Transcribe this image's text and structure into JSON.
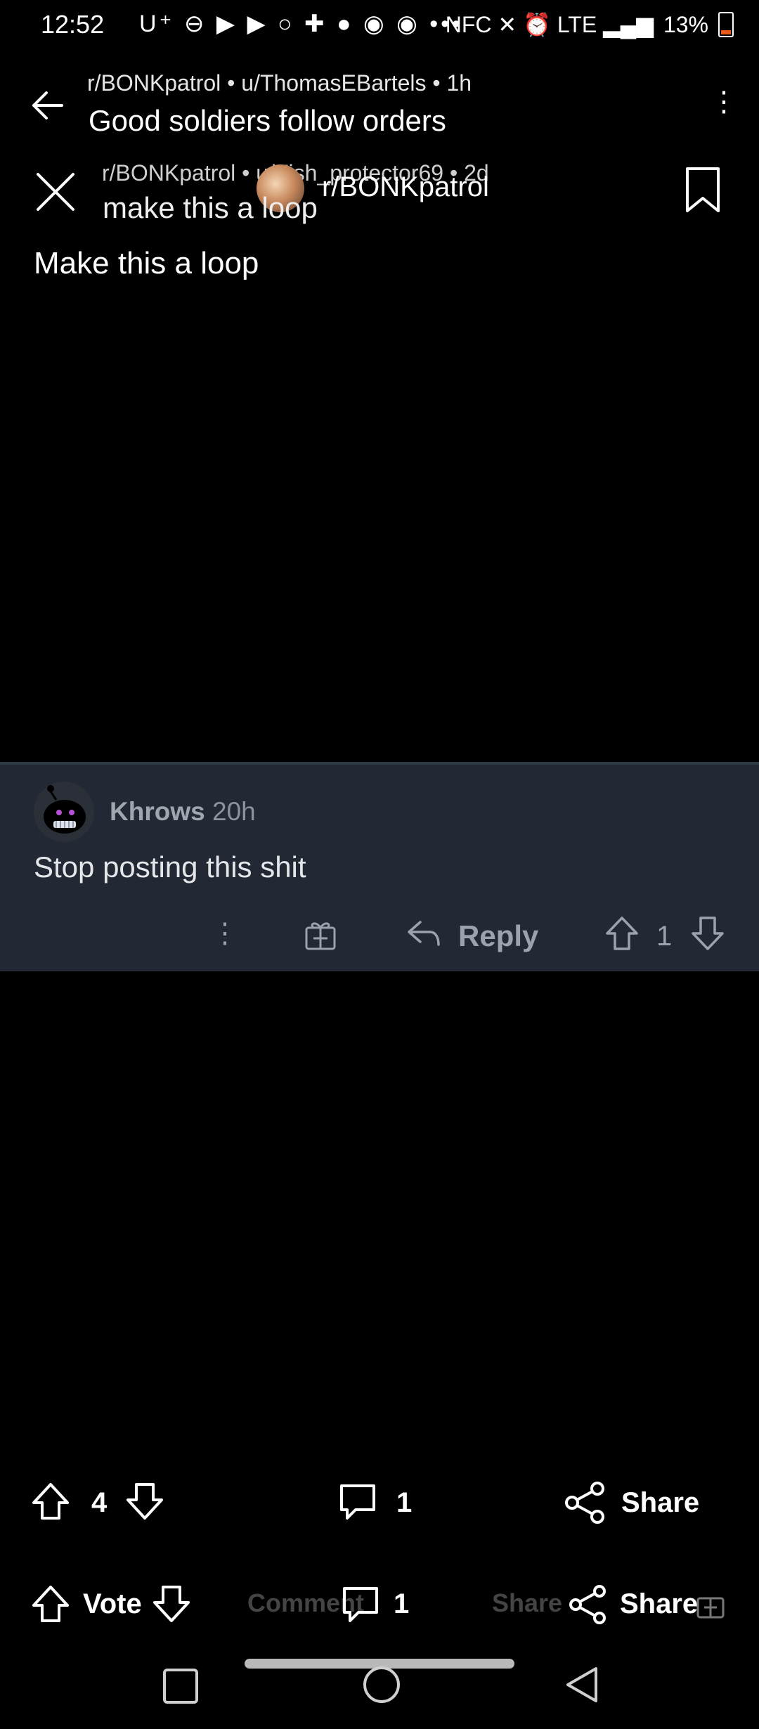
{
  "status_bar": {
    "time": "12:52",
    "left_icons": "U⁺ ⊖ ▶ ▶ ○ ✚ ● ◉ ◉ •••",
    "right_icons": "NFC ✕ ⏰ LTE ▂▄▆",
    "battery": "13%"
  },
  "header_primary": {
    "subtitle": "r/BONKpatrol • u/ThomasEBartels • 1h",
    "title": "Good soldiers follow orders"
  },
  "header_secondary": {
    "subtitle": "r/BONKpatrol • u/Fish_protector69 • 2d",
    "community": "r/BONKpatrol",
    "title": "make this a loop"
  },
  "post": {
    "title": "Make this a loop"
  },
  "comment": {
    "username": "Khrows",
    "time": "20h",
    "body": "Stop posting this shit",
    "reply_label": "Reply",
    "score": "1"
  },
  "action_bar_primary": {
    "score": "4",
    "comment_count": "1",
    "share_label": "Share"
  },
  "action_bar_secondary": {
    "vote_label": "Vote",
    "comment_ghost": "Comment",
    "comment_count": "1",
    "share_ghost": "Share",
    "share_label": "Share"
  },
  "colors": {
    "background": "#000000",
    "comment_bg": "#222834",
    "muted_text": "#9aa3ad",
    "battery_low": "#e8591a"
  }
}
